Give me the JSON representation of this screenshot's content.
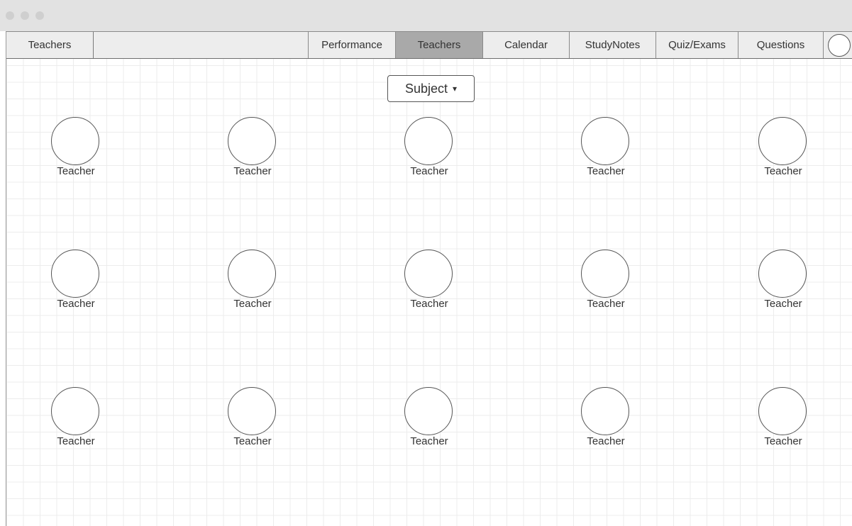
{
  "nav": {
    "title": "Teachers",
    "tabs": [
      {
        "label": "Performance"
      },
      {
        "label": "Teachers"
      },
      {
        "label": "Calendar"
      },
      {
        "label": "StudyNotes"
      },
      {
        "label": "Quiz/Exams"
      },
      {
        "label": "Questions"
      }
    ],
    "active_tab": "Teachers"
  },
  "filter": {
    "label": "Subject",
    "caret": "▾"
  },
  "teachers": [
    {
      "name": "Teacher"
    },
    {
      "name": "Teacher"
    },
    {
      "name": "Teacher"
    },
    {
      "name": "Teacher"
    },
    {
      "name": "Teacher"
    },
    {
      "name": "Teacher"
    },
    {
      "name": "Teacher"
    },
    {
      "name": "Teacher"
    },
    {
      "name": "Teacher"
    },
    {
      "name": "Teacher"
    },
    {
      "name": "Teacher"
    },
    {
      "name": "Teacher"
    },
    {
      "name": "Teacher"
    },
    {
      "name": "Teacher"
    },
    {
      "name": "Teacher"
    }
  ],
  "colors": {
    "active_tab_bg": "#a9a9a9",
    "navbar_bg": "#ededed",
    "titlebar_bg": "#e2e2e2"
  }
}
